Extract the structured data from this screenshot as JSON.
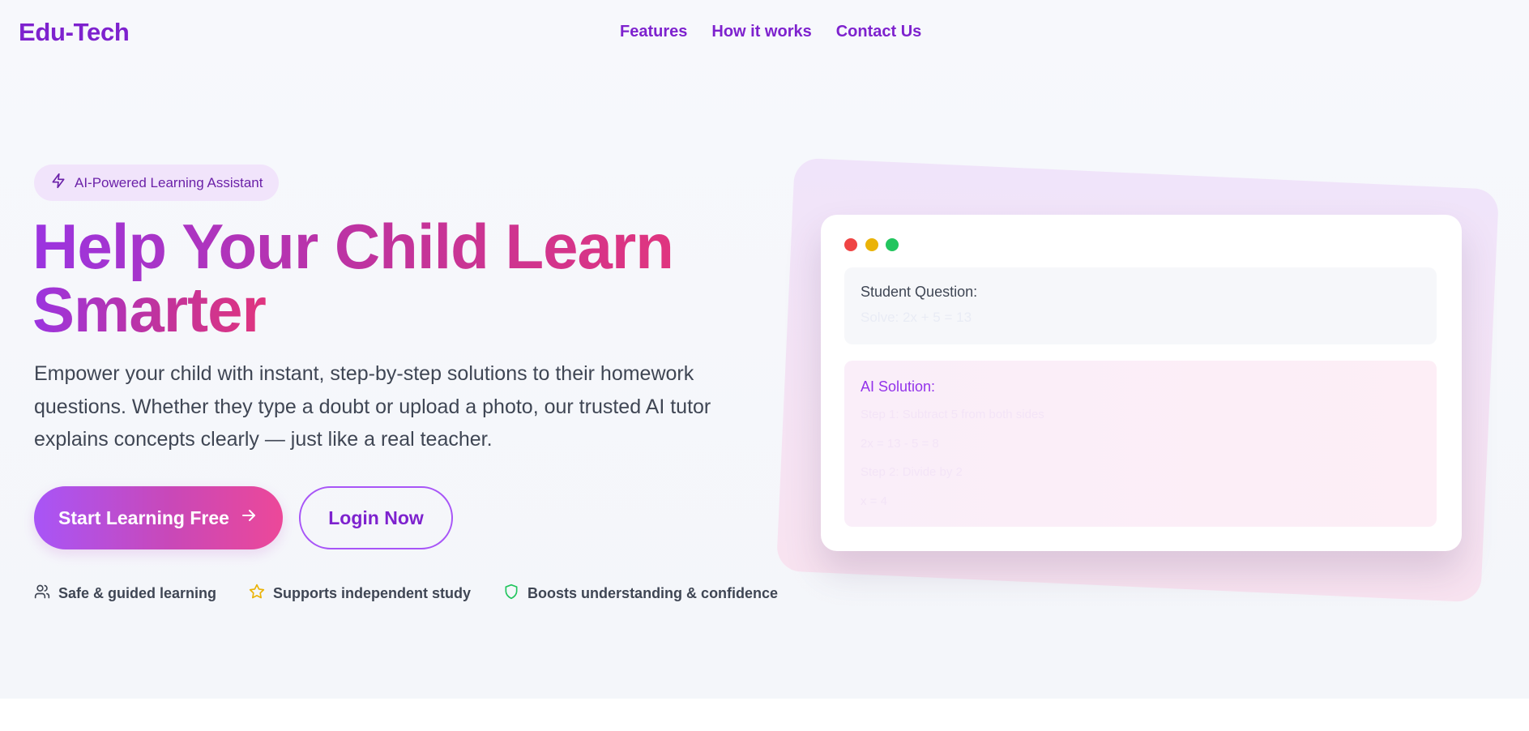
{
  "brand": {
    "logo": "Edu-Tech",
    "accent": "#7e22ce"
  },
  "nav": {
    "links": [
      "Features",
      "How it works",
      "Contact Us"
    ]
  },
  "hero": {
    "badge": {
      "icon": "lightning-icon",
      "label": "AI-Powered Learning Assistant"
    },
    "headline_line1": "Help Your Child Learn",
    "headline_line2": "Smarter",
    "subtext": "Empower your child with instant, step-by-step solutions to their homework questions. Whether they type a doubt or upload a photo, our trusted AI tutor explains concepts clearly — just like a real teacher.",
    "primary_button": {
      "label": "Start Learning Free",
      "icon": "arrow-right-icon"
    },
    "secondary_button": {
      "label": "Login Now"
    },
    "features": [
      {
        "icon": "users-icon",
        "label": "Safe & guided learning"
      },
      {
        "icon": "star-icon",
        "label": "Supports independent study"
      },
      {
        "icon": "shield-icon",
        "label": "Boosts understanding & confidence"
      }
    ]
  },
  "preview": {
    "question_label": "Student Question:",
    "question_text": "Solve: 2x + 5 = 13",
    "solution_label": "AI Solution:",
    "solution_lines": [
      "Step 1: Subtract 5 from both sides",
      "2x = 13 - 5 = 8",
      "Step 2: Divide by 2",
      "x = 4"
    ]
  },
  "colors": {
    "gradient_start": "#a855f7",
    "gradient_end": "#ec4899",
    "window_dots": [
      "#ef4444",
      "#eab308",
      "#22c55e"
    ]
  }
}
